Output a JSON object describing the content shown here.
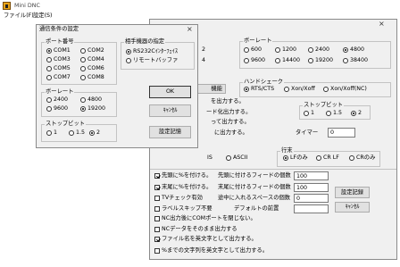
{
  "app": {
    "title": "Mini DNC",
    "icon": "app-icon",
    "menu": [
      "ファイル(F)",
      "設定(S)"
    ]
  },
  "settings_window": {
    "close_label": "×",
    "port_partial": [
      "2",
      "4"
    ],
    "partial_button_label": "機能",
    "baud_rate": {
      "title": "ボーレート",
      "options": [
        {
          "label": "600",
          "checked": false
        },
        {
          "label": "1200",
          "checked": false
        },
        {
          "label": "2400",
          "checked": false
        },
        {
          "label": "4800",
          "checked": true
        },
        {
          "label": "9600",
          "checked": false
        },
        {
          "label": "14400",
          "checked": false
        },
        {
          "label": "19200",
          "checked": false
        },
        {
          "label": "38400",
          "checked": false
        }
      ]
    },
    "handshake": {
      "title": "ハンドシェーク",
      "options": [
        {
          "label": "RTS/CTS",
          "checked": true
        },
        {
          "label": "Xon/Xoff",
          "checked": false
        },
        {
          "label": "Xon/Xoff(NC)",
          "checked": false
        }
      ]
    },
    "partial_option_labels": [
      "を出力する。",
      "ード化出力する。",
      "って出力する。",
      "に出力する。"
    ],
    "stop_bit": {
      "title": "ストップビット",
      "options": [
        {
          "label": "1",
          "checked": false
        },
        {
          "label": "1.5",
          "checked": false
        },
        {
          "label": "2",
          "checked": true
        }
      ]
    },
    "timer": {
      "label": "タイマー",
      "value": "0"
    },
    "code_partial": "IS",
    "code_option": {
      "label": "ASCII",
      "checked": false
    },
    "line_end": {
      "title": "行末",
      "options": [
        {
          "label": "LFのみ",
          "checked": true
        },
        {
          "label": "CR LF",
          "checked": false
        },
        {
          "label": "CRのみ",
          "checked": false
        }
      ]
    },
    "checkboxes": [
      {
        "label": "先頭に%を付ける。",
        "checked": true
      },
      {
        "label": "末尾に%を付ける。",
        "checked": true
      },
      {
        "label": "TVチェック有効",
        "checked": false
      },
      {
        "label": "ラベルスキップ不要",
        "checked": false
      },
      {
        "label": "NC出力後にCOMポートを閉じない。",
        "checked": false
      },
      {
        "label": "NCデータをそのまま出力する",
        "checked": false
      },
      {
        "label": "ファイル名を英文字として出力する。",
        "checked": true
      },
      {
        "label": "%までの文字列を英文字として出力する。",
        "checked": false
      }
    ],
    "fields": [
      {
        "label": "先頭に付けるフィードの個数",
        "value": "100"
      },
      {
        "label": "末尾に付けるフィードの個数",
        "value": "100"
      },
      {
        "label": "途中に入れるスペースの個数",
        "value": "0"
      },
      {
        "label": "デフォルトの前置",
        "value": ""
      }
    ],
    "save_button": "設定記録",
    "cancel_button": "ｷｬﾝｾﾙ"
  },
  "comm_dialog": {
    "title": "通信条件の設定",
    "close_label": "×",
    "port": {
      "title": "ポート番号",
      "options": [
        {
          "label": "COM1",
          "checked": true
        },
        {
          "label": "COM2",
          "checked": false
        },
        {
          "label": "COM3",
          "checked": false
        },
        {
          "label": "COM4",
          "checked": false
        },
        {
          "label": "COM5",
          "checked": false
        },
        {
          "label": "COM6",
          "checked": false
        },
        {
          "label": "COM7",
          "checked": false
        },
        {
          "label": "COM8",
          "checked": false
        }
      ]
    },
    "device": {
      "title": "相手機器の指定",
      "options": [
        {
          "label": "RS232Cｲﾝﾀｰﾌｪｲｽ",
          "checked": true
        },
        {
          "label": "リモートバッファ",
          "checked": false
        }
      ]
    },
    "baud_rate": {
      "title": "ボーレート",
      "options": [
        {
          "label": "2400",
          "checked": false
        },
        {
          "label": "4800",
          "checked": false
        },
        {
          "label": "9600",
          "checked": false
        },
        {
          "label": "19200",
          "checked": true
        }
      ]
    },
    "stop_bit": {
      "title": "ストップビット",
      "options": [
        {
          "label": "1",
          "checked": false
        },
        {
          "label": "1.5",
          "checked": false
        },
        {
          "label": "2",
          "checked": true
        }
      ]
    },
    "ok_button": "OK",
    "cancel_button": "ｷｬﾝｾﾙ",
    "save_button": "設定記憶"
  }
}
